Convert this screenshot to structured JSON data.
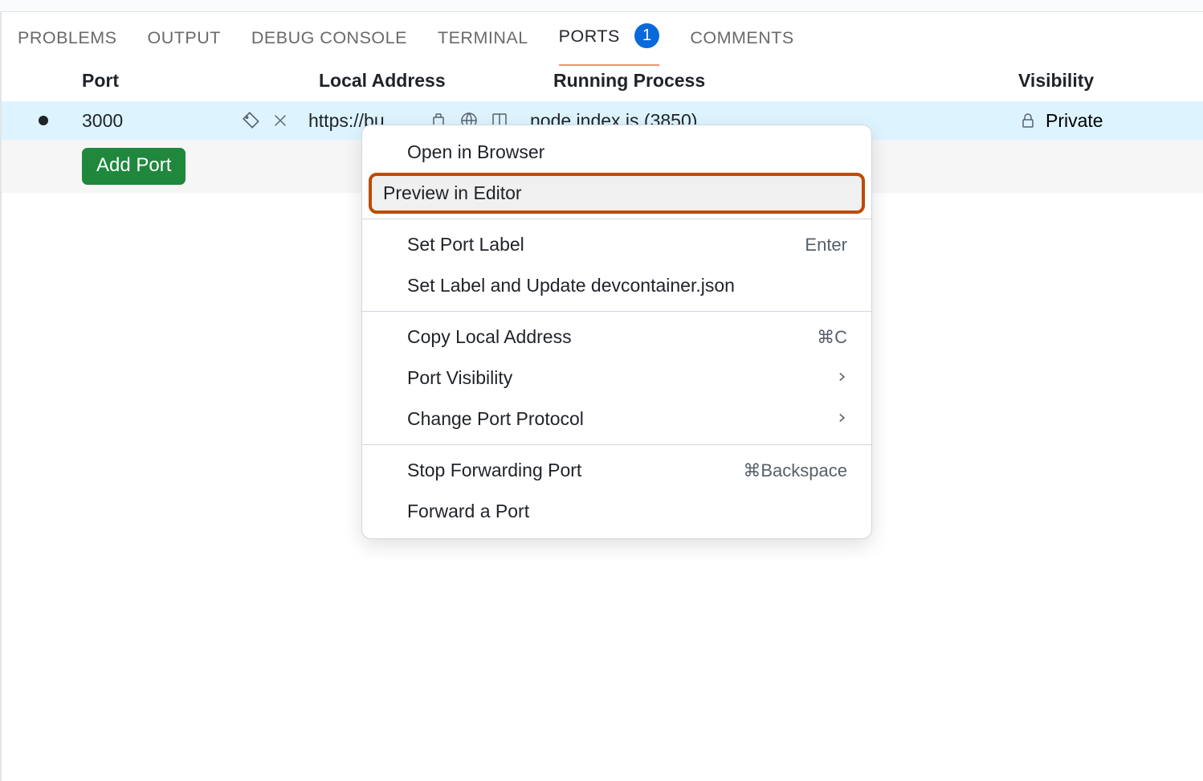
{
  "tabs": {
    "problems": "PROBLEMS",
    "output": "OUTPUT",
    "debug_console": "DEBUG CONSOLE",
    "terminal": "TERMINAL",
    "ports": "PORTS",
    "ports_badge": "1",
    "comments": "COMMENTS"
  },
  "table": {
    "headers": {
      "port": "Port",
      "local_address": "Local Address",
      "running_process": "Running Process",
      "visibility": "Visibility"
    },
    "row": {
      "port": "3000",
      "local_address": "https://bu",
      "running_process": "node index.js (3850)",
      "visibility": "Private"
    },
    "add_button": "Add Port"
  },
  "context_menu": {
    "open_in_browser": "Open in Browser",
    "preview_in_editor": "Preview in Editor",
    "set_port_label": "Set Port Label",
    "set_port_label_shortcut": "Enter",
    "set_label_devcontainer": "Set Label and Update devcontainer.json",
    "copy_local_address": "Copy Local Address",
    "copy_local_address_shortcut": "⌘C",
    "port_visibility": "Port Visibility",
    "change_port_protocol": "Change Port Protocol",
    "stop_forwarding": "Stop Forwarding Port",
    "stop_forwarding_shortcut": "⌘Backspace",
    "forward_a_port": "Forward a Port"
  }
}
